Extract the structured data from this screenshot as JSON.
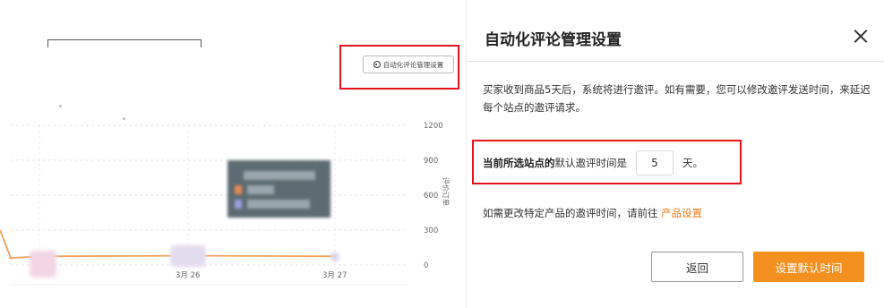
{
  "background": {
    "settings_button_label": "自动化评论管理设置",
    "chart_data": {
      "type": "line",
      "title": "",
      "xlabel": "",
      "ylabel": "评价订单",
      "x_ticks": [
        "3月 26",
        "3月 27"
      ],
      "y_ticks": [
        "1200",
        "900",
        "600",
        "300",
        "0"
      ],
      "ylim": [
        0,
        1200
      ],
      "series": [
        {
          "values": [
            60,
            75,
            80,
            75
          ]
        }
      ],
      "grid": true
    }
  },
  "drawer": {
    "title": "自动化评论管理设置",
    "description": "买家收到商品5天后，系统将进行邀评。如有需要，您可以修改邀评发送时间，来延迟每个站点的邀评请求。",
    "default_prefix_bold": "当前所选站点的",
    "default_prefix": "默认邀评时间是",
    "default_days": "5",
    "default_suffix": "天。",
    "product_text": "如需更改特定产品的邀评时间，请前往",
    "product_link": "产品设置",
    "back_label": "返回",
    "primary_label": "设置默认时间",
    "accent_color": "#f39020",
    "highlight_color": "#e8121e"
  }
}
